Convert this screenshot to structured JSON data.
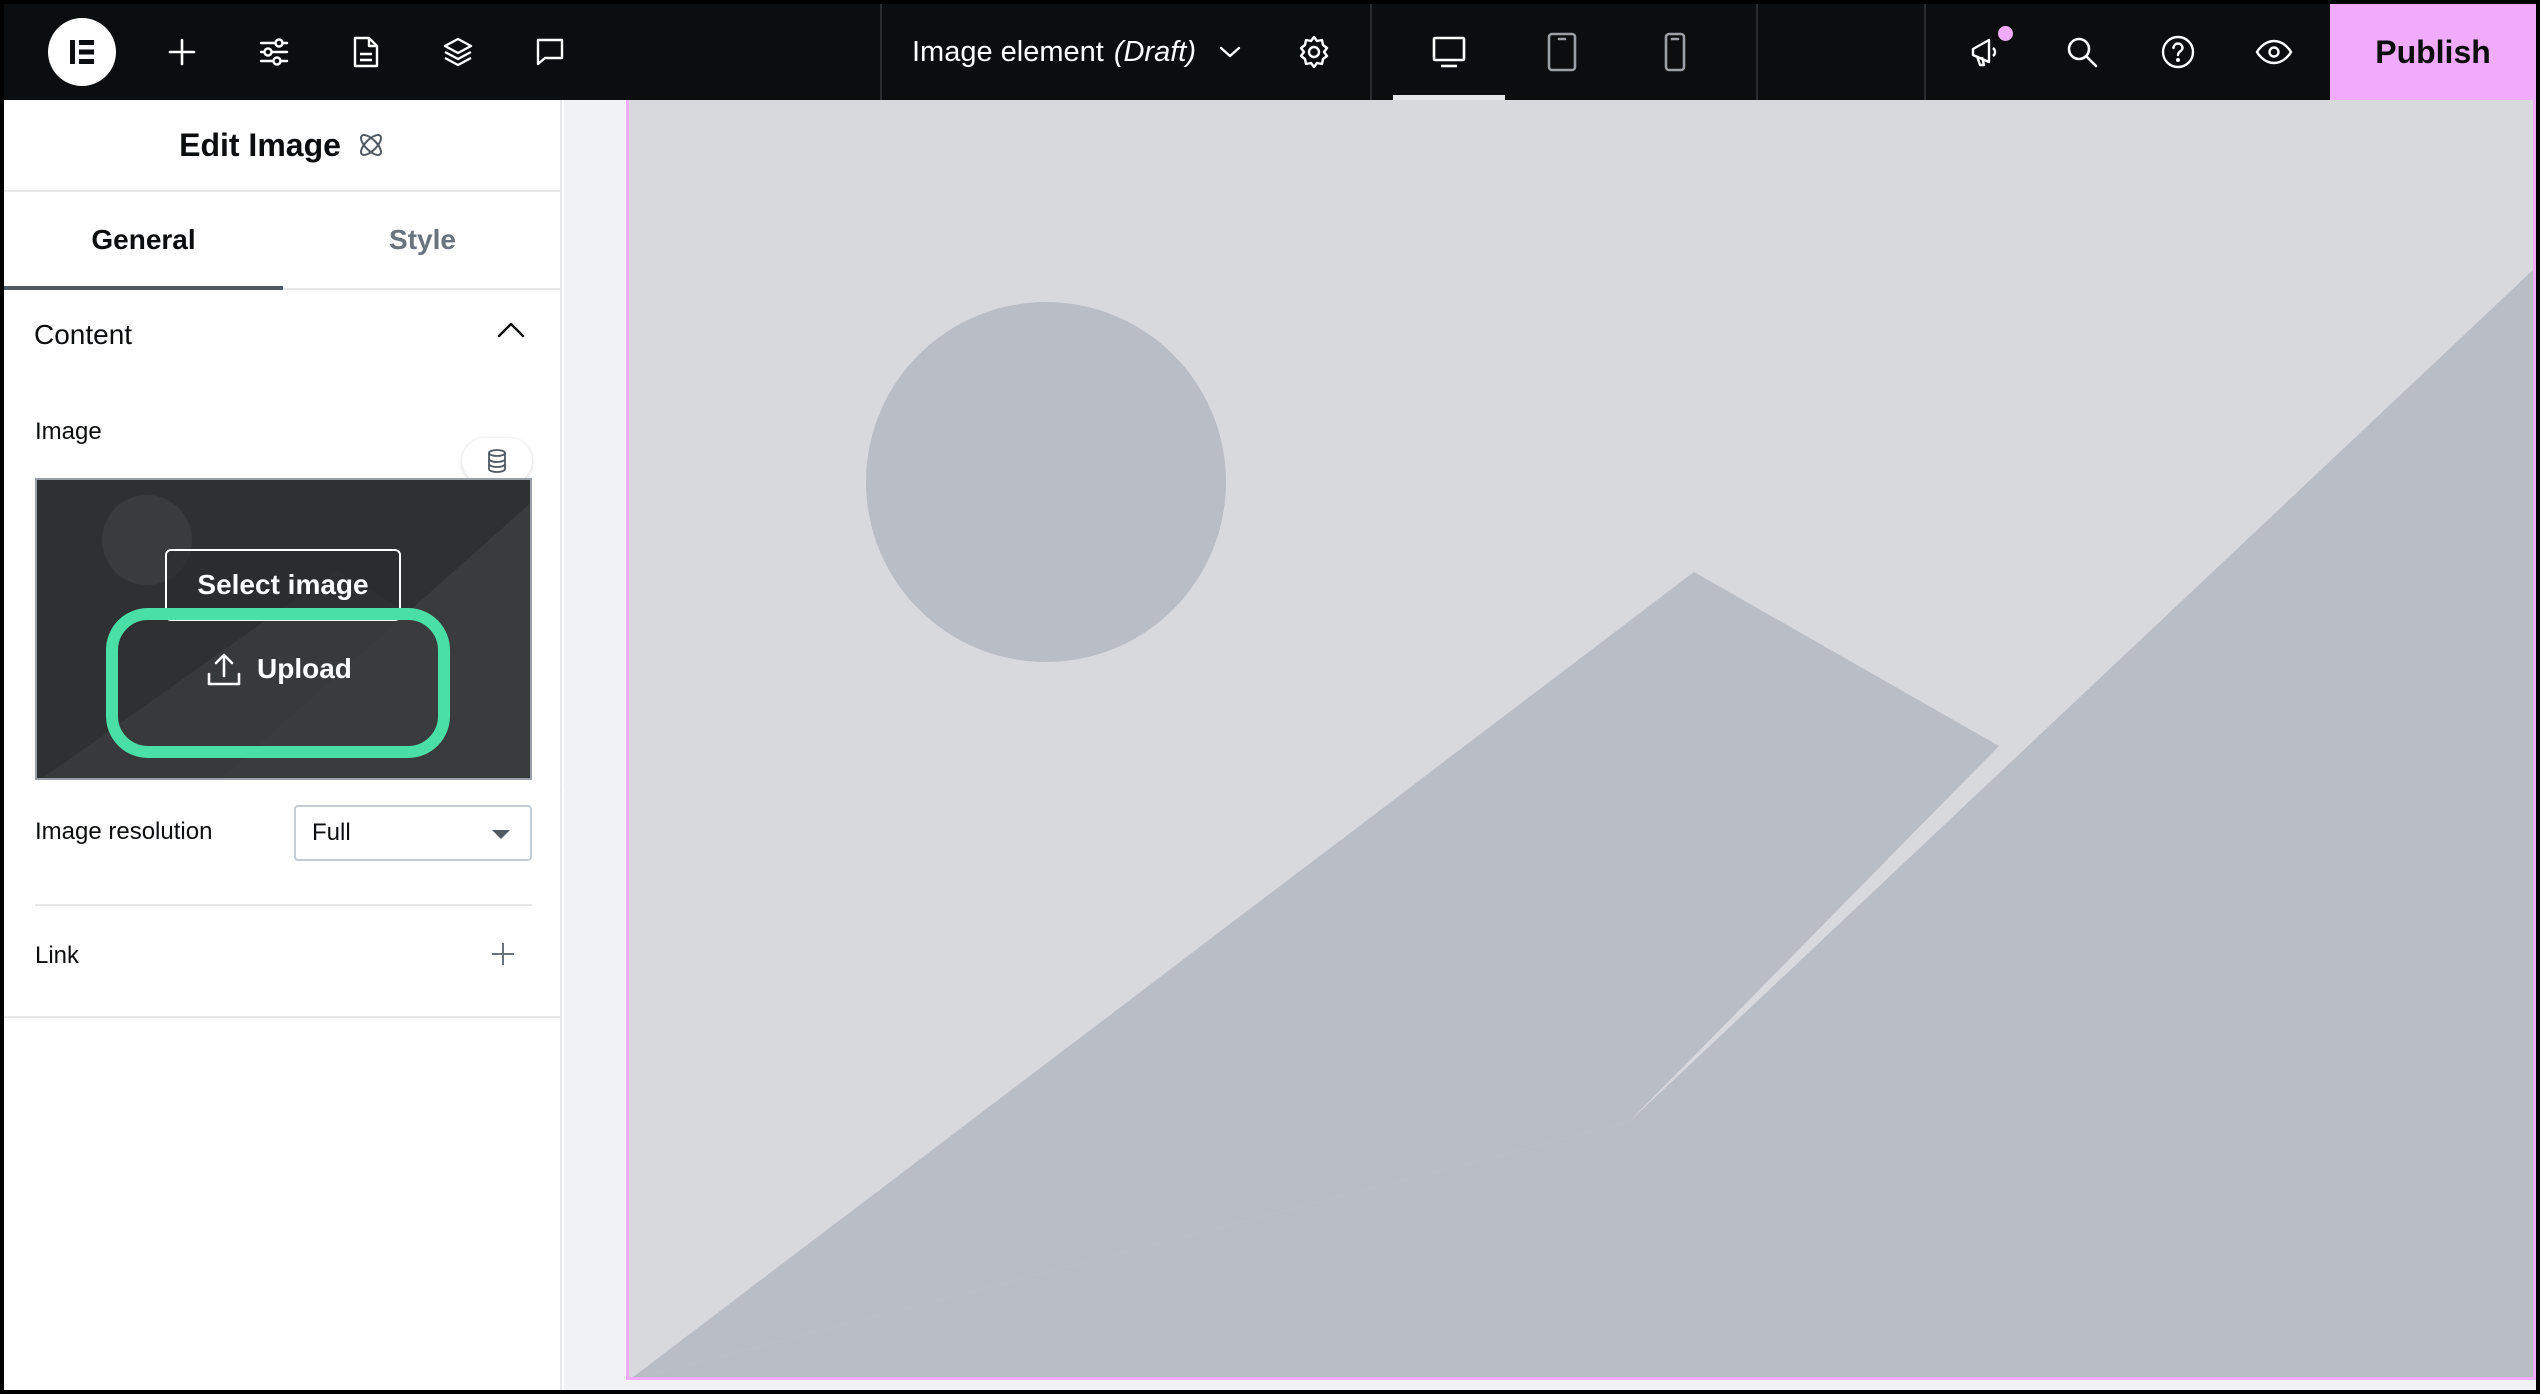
{
  "app": {
    "name": "Elementor"
  },
  "topbar": {
    "doc_title": "Image element",
    "doc_status": "(Draft)",
    "publish_label": "Publish"
  },
  "panel": {
    "title": "Edit Image",
    "tabs": [
      {
        "label": "General",
        "active": true
      },
      {
        "label": "Style",
        "active": false
      }
    ],
    "section_label": "Content",
    "image_label": "Image",
    "select_image_label": "Select image",
    "upload_label": "Upload",
    "resolution_label": "Image resolution",
    "resolution_value": "Full",
    "link_label": "Link"
  },
  "colors": {
    "topbar_bg": "#0c0d0e",
    "accent": "#f0abfc",
    "highlight": "#4adfa6",
    "placeholder_bg": "#d8d9dd",
    "placeholder_shape": "#b9bdc4"
  }
}
